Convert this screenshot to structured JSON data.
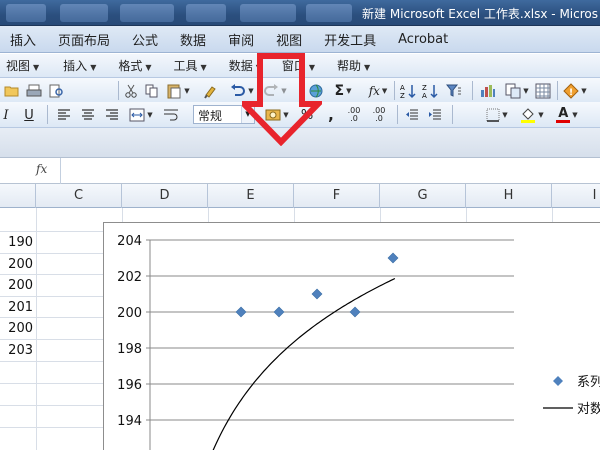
{
  "window": {
    "title": "新建 Microsoft Excel 工作表.xlsx - Micros"
  },
  "ribbon_tabs": [
    "插入",
    "页面布局",
    "公式",
    "数据",
    "审阅",
    "视图",
    "开发工具",
    "Acrobat"
  ],
  "menubar": [
    "视图",
    "插入",
    "格式",
    "工具",
    "数据",
    "窗口",
    "帮助"
  ],
  "toolbar": {
    "number_format": "常规",
    "sum_symbol": "Σ",
    "function_symbol": "fx",
    "comma_label": ",",
    "percent_label": "%",
    "inc_decimal_label": ".00 .0",
    "dec_decimal_label": ".00 .0",
    "italic_label": "I",
    "underline_label": "U",
    "font_color_label": "A"
  },
  "formula_bar": {
    "fx_label": "fx"
  },
  "columns": [
    "C",
    "D",
    "E",
    "F",
    "G",
    "H",
    "I"
  ],
  "cells": [
    "190",
    "200",
    "200",
    "201",
    "200",
    "203"
  ],
  "chart_data": {
    "type": "scatter",
    "y_ticks": [
      "204",
      "202",
      "200",
      "198",
      "196",
      "194"
    ],
    "ylim": [
      194,
      204
    ],
    "points": [
      {
        "x": 2,
        "y": 200
      },
      {
        "x": 3,
        "y": 200
      },
      {
        "x": 4,
        "y": 201
      },
      {
        "x": 5,
        "y": 200
      },
      {
        "x": 6,
        "y": 203
      }
    ],
    "trendline": {
      "type": "logarithmic",
      "intercept": 190.88,
      "slope": 6.1
    },
    "legend": [
      {
        "label": "系列",
        "marker": "diamond"
      },
      {
        "label": "对数",
        "marker": "line"
      }
    ],
    "marker_color": "#4f81bd"
  },
  "colors": {
    "annotation_arrow": "#e8242c",
    "titlebar": "#2b4f7e"
  }
}
